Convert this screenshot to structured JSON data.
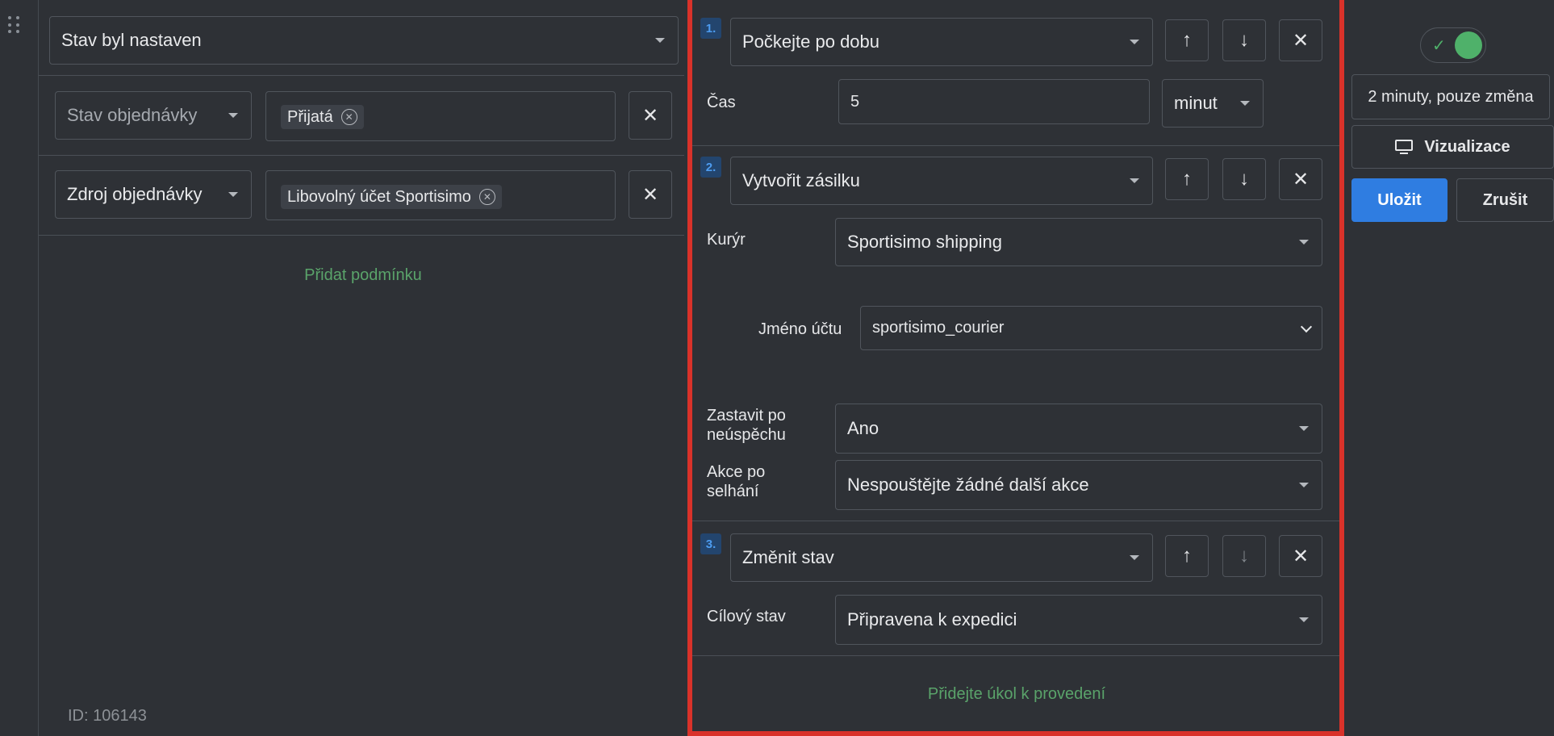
{
  "trigger": {
    "value": "Stav byl nastaven"
  },
  "conditions": [
    {
      "field": "Stav objednávky",
      "tags": [
        "Přijatá"
      ]
    },
    {
      "field": "Zdroj objednávky",
      "tags": [
        "Libovolný účet Sportisimo"
      ]
    }
  ],
  "add_condition_label": "Přidat podmínku",
  "rule_id": "ID: 106143",
  "tasks": [
    {
      "number": "1.",
      "action": "Počkejte po dobu",
      "time_label": "Čas",
      "time_value": "5",
      "time_unit": "minut"
    },
    {
      "number": "2.",
      "action": "Vytvořit zásilku",
      "courier_label": "Kurýr",
      "courier_value": "Sportisimo shipping",
      "account_label": "Jméno účtu",
      "account_value": "sportisimo_courier",
      "stop_label": "Zastavit po neúspěchu",
      "stop_value": "Ano",
      "fail_label": "Akce po selhání",
      "fail_value": "Nespouštějte žádné další akce"
    },
    {
      "number": "3.",
      "action": "Změnit stav",
      "target_label": "Cílový stav",
      "target_value": "Připravena k expedici"
    }
  ],
  "add_task_label": "Přidejte úkol k provedení",
  "sidebar": {
    "enabled": true,
    "schedule_value": "2 minuty, pouze změna",
    "visualize_label": "Vizualizace",
    "save_label": "Uložit",
    "cancel_label": "Zrušit"
  },
  "colors": {
    "background": "#2e3136",
    "accent_red": "#d9322a",
    "primary_blue": "#2f7de1",
    "success_green": "#4fb16a",
    "link_green": "#5aa36a"
  }
}
